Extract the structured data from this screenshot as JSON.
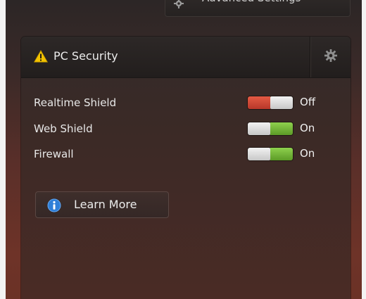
{
  "top_button": {
    "label": "Advanced Settings"
  },
  "panel": {
    "title": "PC Security",
    "header_icon": "warning-triangle-icon",
    "settings_icon": "gear-icon"
  },
  "shields": [
    {
      "label": "Realtime Shield",
      "state": "Off",
      "enabled": false
    },
    {
      "label": "Web Shield",
      "state": "On",
      "enabled": true
    },
    {
      "label": "Firewall",
      "state": "On",
      "enabled": true
    }
  ],
  "learn_more": {
    "label": "Learn More",
    "icon": "info-icon"
  },
  "colors": {
    "toggle_off": "#d0483a",
    "toggle_on": "#77b63a",
    "warning": "#f2c200",
    "info": "#2f7fd8"
  }
}
